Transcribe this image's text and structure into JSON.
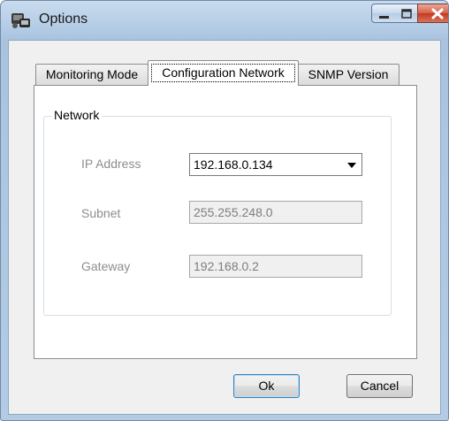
{
  "window": {
    "title": "Options"
  },
  "tabs": [
    {
      "label": "Monitoring Mode",
      "selected": false
    },
    {
      "label": "Configuration Network",
      "selected": true
    },
    {
      "label": "SNMP Version",
      "selected": false
    }
  ],
  "network": {
    "group_title": "Network",
    "ip_address": {
      "label": "IP Address",
      "value": "192.168.0.134"
    },
    "subnet": {
      "label": "Subnet",
      "value": "255.255.248.0"
    },
    "gateway": {
      "label": "Gateway",
      "value": "192.168.0.2"
    }
  },
  "buttons": {
    "ok": "Ok",
    "cancel": "Cancel"
  },
  "icons": {
    "app": "app-icon",
    "minimize": "minimize-icon",
    "maximize": "maximize-icon",
    "close": "close-icon",
    "dropdown": "chevron-down-icon"
  },
  "colors": {
    "titlebar": "#b4cce6",
    "close_button": "#c3391f",
    "disabled_label": "#8d8d8d"
  }
}
